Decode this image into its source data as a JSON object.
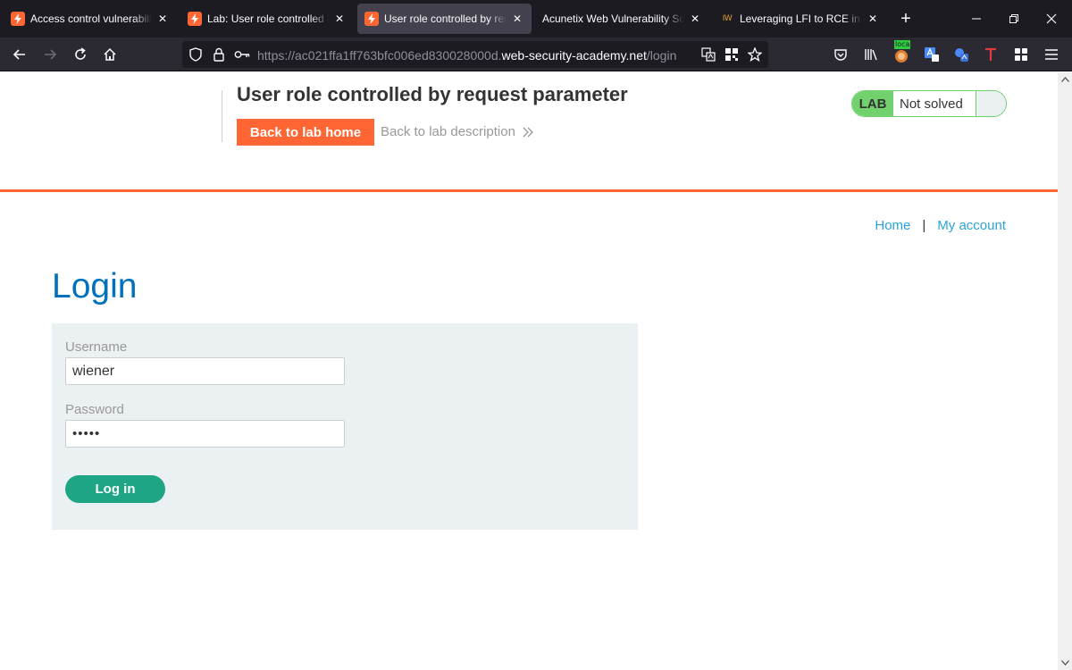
{
  "browser": {
    "tabs": [
      {
        "title": "Access control vulnerabilities",
        "icon": "portswigger-icon",
        "active": false
      },
      {
        "title": "Lab: User role controlled by r",
        "icon": "portswigger-icon",
        "active": false
      },
      {
        "title": "User role controlled by reque",
        "icon": "portswigger-icon",
        "active": true
      },
      {
        "title": "Acunetix Web Vulnerability Scann",
        "icon": "none",
        "active": false
      },
      {
        "title": "Leveraging LFI to RCE in a we",
        "icon": "iw-icon",
        "active": false
      }
    ],
    "tab_iw_glyph": "IW",
    "url_prefix": "https://ac021ffa1ff763bfc006ed830028000d.",
    "url_host": "web-security-academy.net",
    "url_path": "/login",
    "ext_badge": "loca"
  },
  "lab": {
    "title": "User role controlled by request parameter",
    "back_home": "Back to lab home",
    "back_description": "Back to lab description",
    "status_tag": "LAB",
    "status_text": "Not solved"
  },
  "nav": {
    "home": "Home",
    "separator": "|",
    "my_account": "My account"
  },
  "login": {
    "heading": "Login",
    "username_label": "Username",
    "username_value": "wiener",
    "password_label": "Password",
    "password_value": "•••••",
    "submit": "Log in"
  },
  "colors": {
    "accent": "#ff6633",
    "link": "#29a3d8",
    "heading": "#0071bc",
    "status_green": "#70d16d",
    "button_green": "#1da586",
    "panel": "#ebf0f2"
  }
}
